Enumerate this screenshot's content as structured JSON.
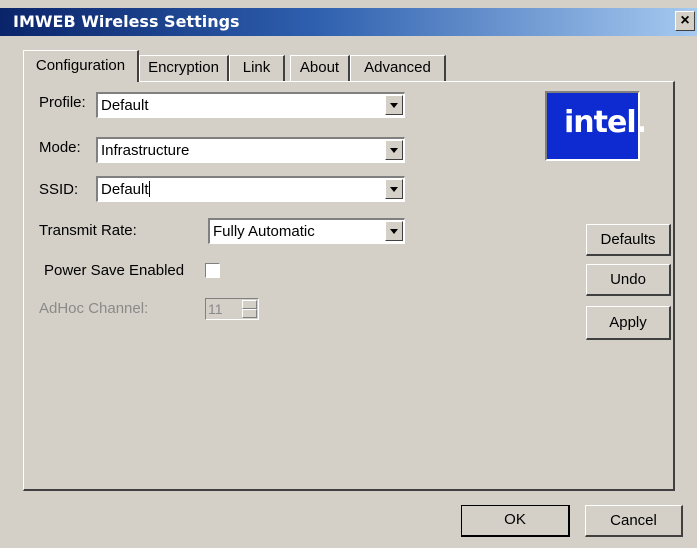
{
  "window": {
    "title": "IMWEB Wireless Settings",
    "close_glyph": "✕"
  },
  "tabs": [
    {
      "label": "Configuration",
      "active": true
    },
    {
      "label": "Encryption",
      "active": false
    },
    {
      "label": "Link",
      "active": false
    },
    {
      "label": "About",
      "active": false
    },
    {
      "label": "Advanced",
      "active": false
    }
  ],
  "config": {
    "profile_label": "Profile:",
    "profile_value": "Default",
    "mode_label": "Mode:",
    "mode_value": "Infrastructure",
    "ssid_label": "SSID:",
    "ssid_value": "Default",
    "transmit_label": "Transmit Rate:",
    "transmit_value": "Fully Automatic",
    "power_save_label": "Power Save Enabled",
    "power_save_checked": false,
    "adhoc_label": "AdHoc Channel:",
    "adhoc_value": "11"
  },
  "logo": {
    "text": "intel.",
    "bg_color": "#0d2bd0"
  },
  "side_buttons": {
    "defaults": "Defaults",
    "undo": "Undo",
    "apply": "Apply"
  },
  "footer": {
    "ok": "OK",
    "cancel": "Cancel"
  },
  "colors": {
    "titlebar_start": "#0a246a",
    "titlebar_end": "#a6caf0",
    "face": "#d4d0c8"
  }
}
